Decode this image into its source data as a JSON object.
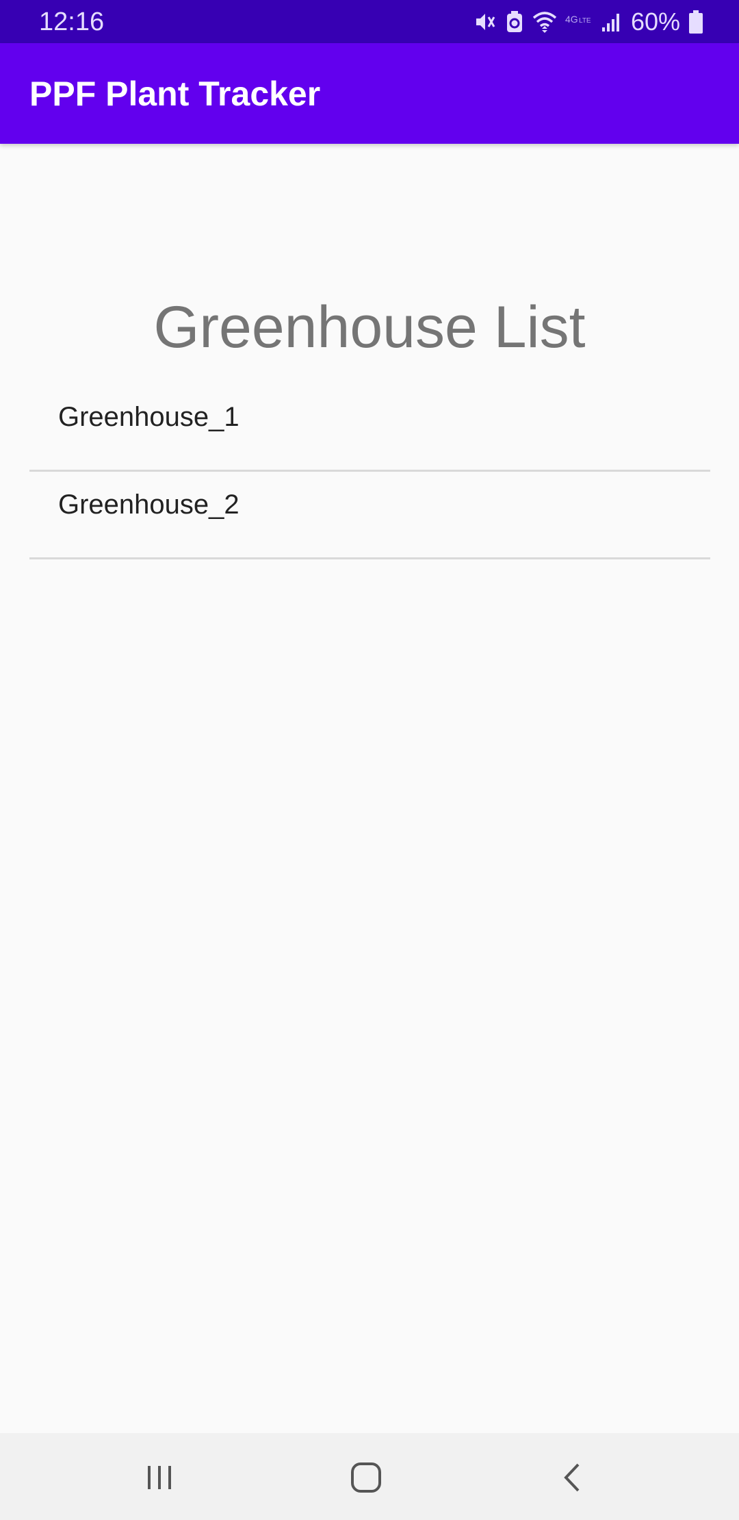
{
  "status_bar": {
    "time": "12:16",
    "battery_percent": "60%",
    "icons": [
      "mute-vibrate-icon",
      "battery-saver-icon",
      "wifi-icon",
      "lte-icon",
      "signal-icon",
      "battery-icon"
    ]
  },
  "app_bar": {
    "title": "PPF Plant Tracker",
    "color": "#6200ee"
  },
  "status_color": "#3700b3",
  "main": {
    "heading": "Greenhouse List",
    "greenhouses": [
      {
        "label": "Greenhouse_1"
      },
      {
        "label": "Greenhouse_2"
      }
    ]
  },
  "nav_bar": {
    "buttons": [
      "recents-icon",
      "home-icon",
      "back-icon"
    ]
  }
}
